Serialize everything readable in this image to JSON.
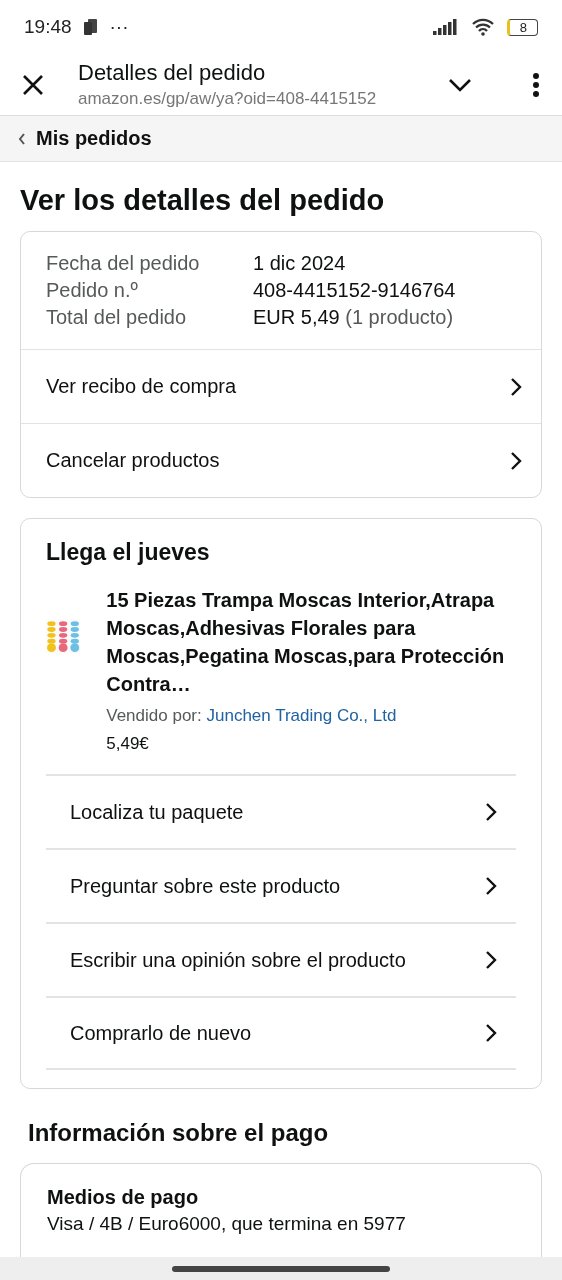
{
  "status_bar": {
    "time": "19:48",
    "dots": "···",
    "battery": "8"
  },
  "browser_bar": {
    "title": "Detalles del pedido",
    "url": "amazon.es/gp/aw/ya?oid=408-4415152"
  },
  "breadcrumb": {
    "label": "Mis pedidos"
  },
  "page_title": "Ver los detalles del pedido",
  "summary": {
    "rows": [
      {
        "label": "Fecha del pedido",
        "value": "1 dic 2024"
      },
      {
        "label": "Pedido n.º",
        "value": "408-4415152-9146764"
      },
      {
        "label": "Total del pedido",
        "value": "EUR 5,49",
        "note": "(1 producto)"
      }
    ],
    "links": [
      "Ver recibo de compra",
      "Cancelar productos"
    ]
  },
  "shipment": {
    "heading": "Llega el jueves",
    "product": {
      "kind": "picture",
      "title": "15 Piezas Trampa Moscas Interior,Atrapa Moscas,Adhesivas Florales para Moscas,Pegatina Moscas,para Protección Contra…",
      "seller_label": "Vendido por:",
      "seller": "Junchen Trading Co., Ltd",
      "price": "5,49€"
    },
    "actions": [
      "Localiza tu paquete",
      "Preguntar sobre este producto",
      "Escribir una opinión sobre el producto",
      "Comprarlo de nuevo"
    ]
  },
  "payment": {
    "heading": "Información sobre el pago",
    "card_title": "Medios de pago",
    "method": "Visa / 4B / Euro6000, que termina en 5977"
  }
}
